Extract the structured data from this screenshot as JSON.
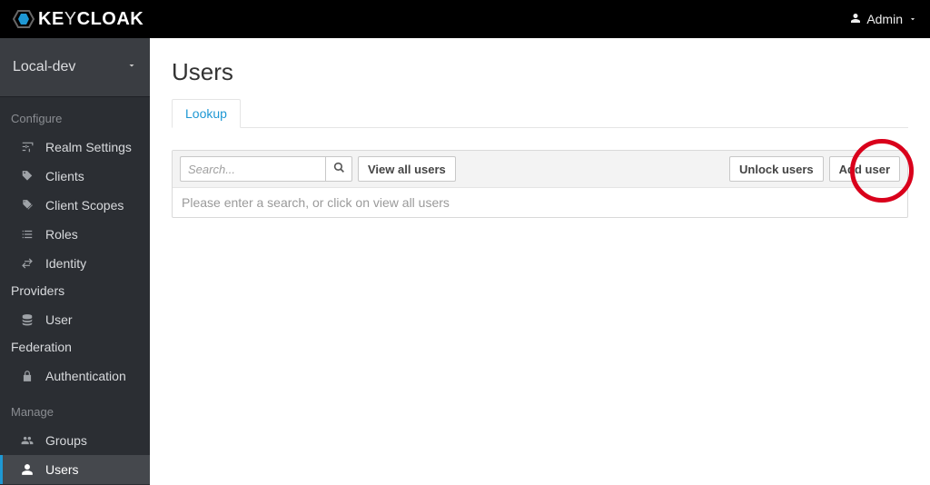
{
  "brand": {
    "name_left": "KE",
    "name_mid": "Y",
    "name_right": "CLOAK"
  },
  "header": {
    "user_label": "Admin"
  },
  "realm": {
    "name": "Local-dev"
  },
  "sidebar": {
    "sections": [
      {
        "title": "Configure"
      },
      {
        "title": "Manage"
      }
    ],
    "configure": [
      {
        "label": "Realm Settings",
        "icon": "sliders-icon"
      },
      {
        "label": "Clients",
        "icon": "tag-icon"
      },
      {
        "label": "Client Scopes",
        "icon": "tags-icon"
      },
      {
        "label": "Roles",
        "icon": "list-icon"
      },
      {
        "label": "Identity",
        "label2": "Providers",
        "icon": "swap-icon"
      },
      {
        "label": "User",
        "label2": "Federation",
        "icon": "database-icon"
      },
      {
        "label": "Authentication",
        "icon": "lock-icon"
      }
    ],
    "manage": [
      {
        "label": "Groups",
        "icon": "users-icon"
      },
      {
        "label": "Users",
        "icon": "user-icon",
        "active": true
      }
    ]
  },
  "page": {
    "title": "Users",
    "tabs": [
      {
        "label": "Lookup",
        "active": true
      }
    ],
    "search": {
      "placeholder": "Search..."
    },
    "buttons": {
      "view_all": "View all users",
      "unlock": "Unlock users",
      "add": "Add user"
    },
    "hint": "Please enter a search, or click on view all users"
  }
}
